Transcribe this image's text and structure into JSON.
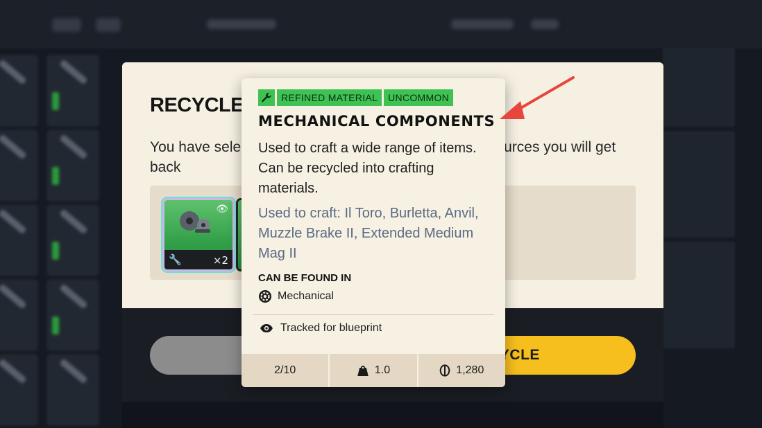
{
  "dialog": {
    "title": "RECYCLE",
    "description": "You have selected items to recycle. These are the resources you will get back",
    "recycle_button": "RECYCLE",
    "items": [
      {
        "name": "Mechanical Components",
        "quantity": "×2"
      }
    ]
  },
  "tooltip": {
    "tags": [
      "REFINED MATERIAL",
      "UNCOMMON"
    ],
    "title": "MECHANICAL COMPONENTS",
    "description": "Used to craft a wide range of items. Can be recycled into crafting materials.",
    "used_to_craft_label": "Used to craft:",
    "used_to_craft": "Il Toro, Burletta, Anvil, Muzzle Brake II, Extended Medium Mag II",
    "found_in_label": "CAN BE FOUND IN",
    "found_in": "Mechanical",
    "tracked": "Tracked for blueprint",
    "stats": {
      "stack": "2/10",
      "weight": "1.0",
      "value": "1,280"
    }
  },
  "colors": {
    "tag_green": "#3ec253",
    "recycle_yellow": "#f7bf1e",
    "annotation_arrow": "#e8453c"
  }
}
